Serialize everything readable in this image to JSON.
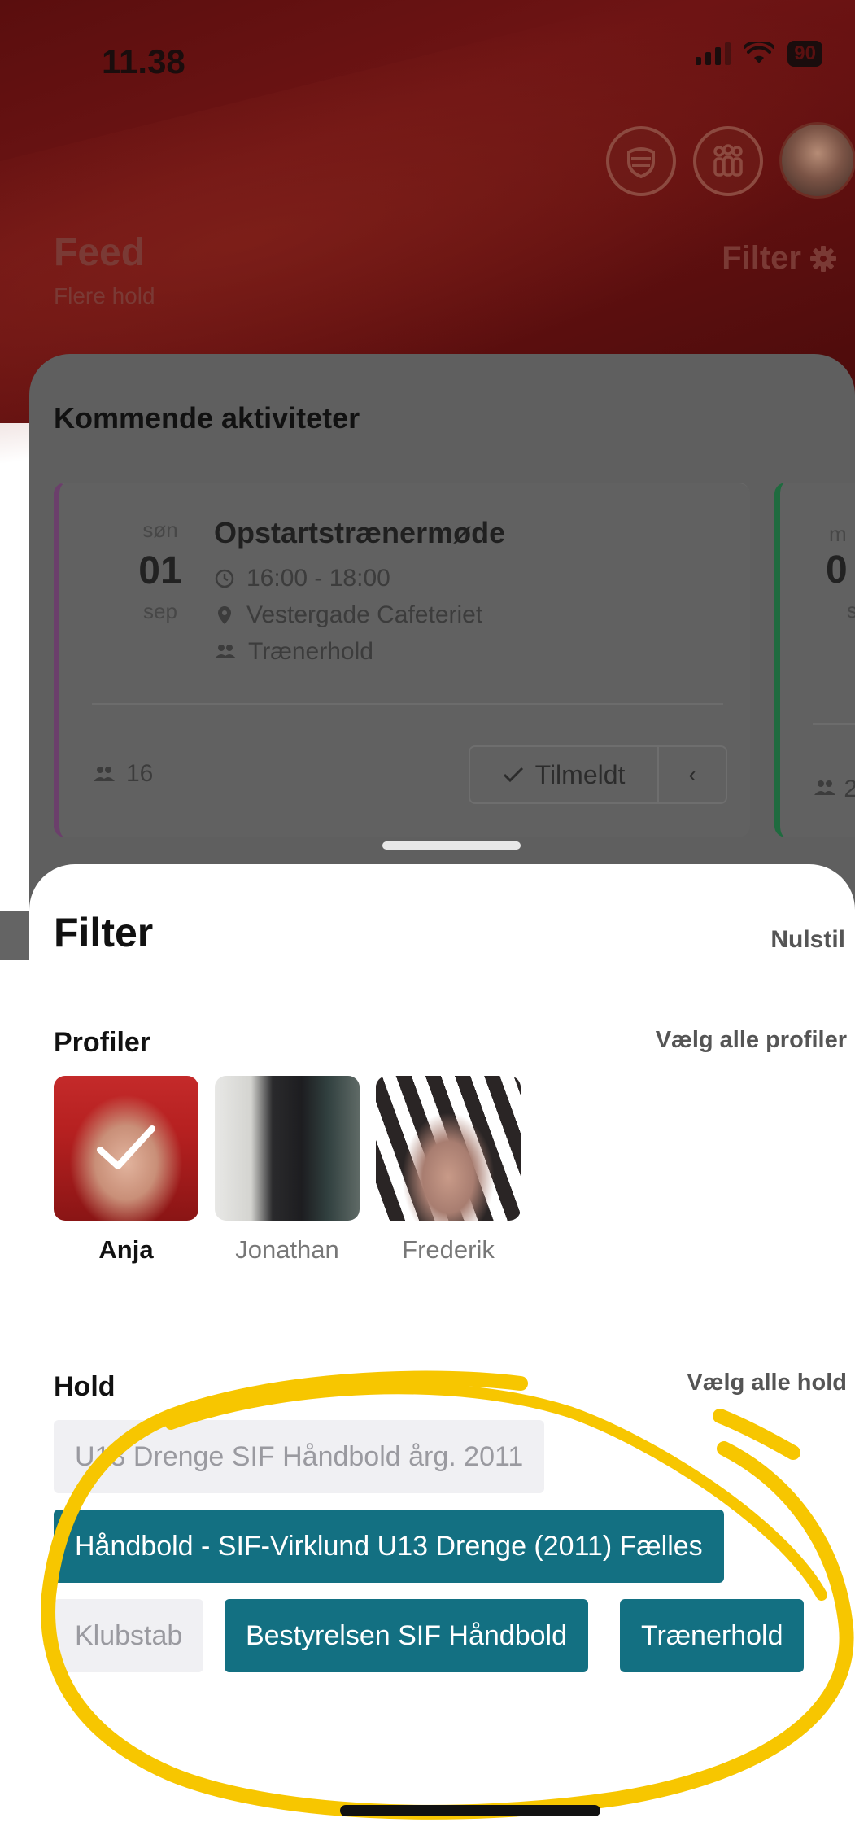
{
  "status_bar": {
    "time": "11.38",
    "battery": "90"
  },
  "header": {
    "title": "Feed",
    "subtitle": "Flere hold",
    "filter_label": "Filter",
    "icons": [
      "club-icon",
      "teams-icon",
      "avatar"
    ]
  },
  "feed": {
    "section_title": "Kommende aktiviteter",
    "activities": [
      {
        "day": "søn",
        "date": "01",
        "month": "sep",
        "title": "Opstartstrænermøde",
        "time": "16:00 - 18:00",
        "location": "Vestergade Cafeteriet",
        "team": "Trænerhold",
        "participants": "16",
        "status": "Tilmeldt",
        "accent": "#6b3f6b"
      },
      {
        "day": "m",
        "date": "0",
        "month": "se",
        "participants": "2",
        "accent": "#1f6b3f"
      }
    ]
  },
  "filter_sheet": {
    "title": "Filter",
    "reset_label": "Nulstil",
    "profiles": {
      "label": "Profiler",
      "select_all": "Vælg alle profiler",
      "items": [
        {
          "name": "Anja",
          "selected": true
        },
        {
          "name": "Jonathan",
          "selected": false
        },
        {
          "name": "Frederik",
          "selected": false
        }
      ]
    },
    "teams": {
      "label": "Hold",
      "select_all": "Vælg alle hold",
      "items": [
        {
          "name": "U13 Drenge SIF Håndbold årg. 2011",
          "selected": false
        },
        {
          "name": "Håndbold - SIF-Virklund U13 Drenge (2011) Fælles",
          "selected": true
        },
        {
          "name": "Klubstab",
          "selected": false
        },
        {
          "name": "Bestyrelsen SIF Håndbold",
          "selected": true
        },
        {
          "name": "Trænerhold",
          "selected": true
        }
      ]
    }
  },
  "colors": {
    "header_red": "#6e1414",
    "chip_selected": "#137082",
    "chip_unselected": "#f0f0f3",
    "annotation_yellow": "#f7c600"
  }
}
